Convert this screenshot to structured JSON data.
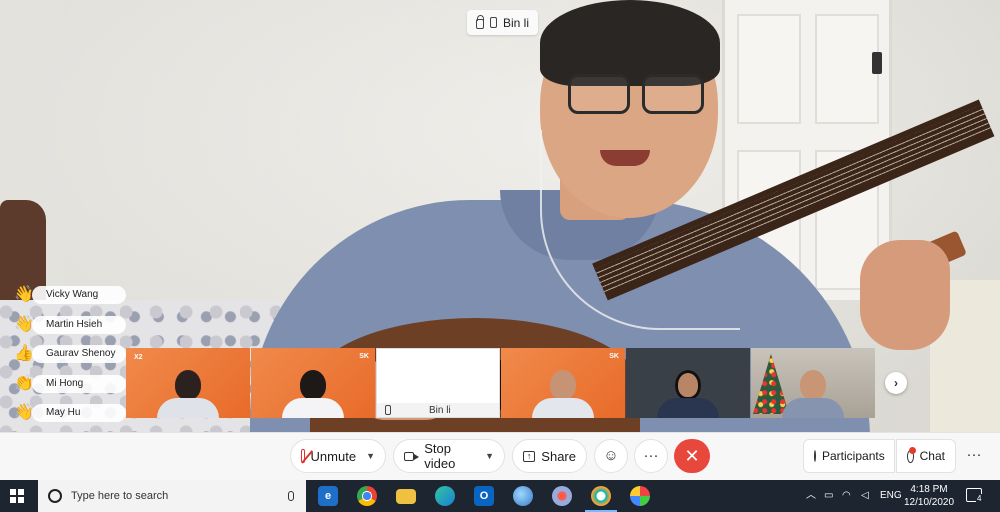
{
  "meeting": {
    "active_speaker": "Bin li"
  },
  "raised_hands": [
    {
      "name": "Vicky Wang",
      "reaction": "wave"
    },
    {
      "name": "Martin Hsieh",
      "reaction": "wave"
    },
    {
      "name": "Gaurav Shenoy",
      "reaction": "thumbs-up"
    },
    {
      "name": "Mi Hong",
      "reaction": "clap"
    },
    {
      "name": "May Hu",
      "reaction": "wave"
    }
  ],
  "thumbnails": {
    "t1_badge": "X2",
    "t2_badge": "SK",
    "self_name": "Bin li",
    "t4_badge": "SK"
  },
  "controls": {
    "unmute": "Unmute",
    "stop_video": "Stop video",
    "share": "Share",
    "participants": "Participants",
    "chat": "Chat",
    "more": "···",
    "end_icon": "✕",
    "reactions_icon": "☺"
  },
  "taskbar": {
    "search_placeholder": "Type here to search",
    "lang": "ENG",
    "time": "4:18 PM",
    "date": "12/10/2020",
    "notifications": "4"
  },
  "colors": {
    "end_button": "#e8473b",
    "thumb_orange": "#ee7a3a",
    "taskbar": "#1d2530"
  }
}
